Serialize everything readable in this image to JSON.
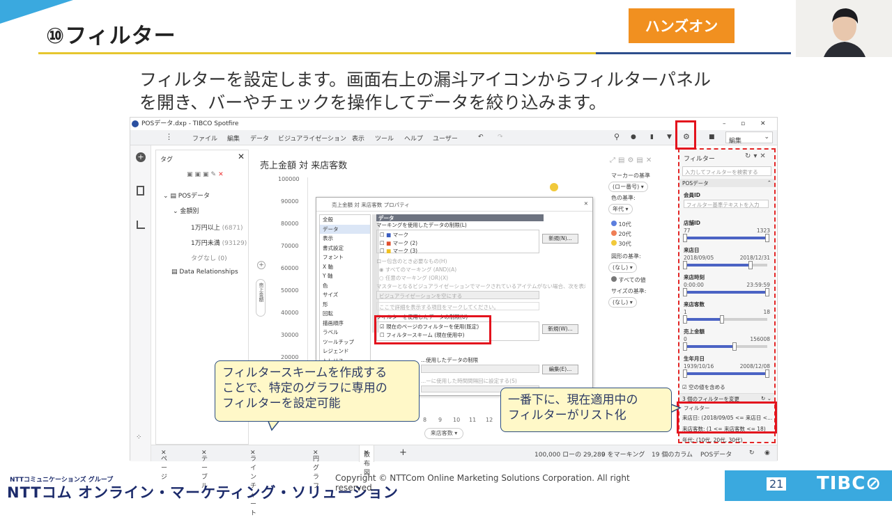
{
  "slide": {
    "title": "⑩フィルター",
    "badge": "ハンズオン",
    "description_line1": "フィルターを設定します。画面右上の漏斗アイコンからフィルターパネル",
    "description_line2": "を開き、バーやチェックを操作してデータを絞り込みます。"
  },
  "app": {
    "window_title": "POSデータ.dxp - TIBCO Spotfire",
    "menu": [
      "ファイル",
      "編集",
      "データ",
      "ビジュアライゼーション",
      "表示",
      "ツール",
      "ヘルプ",
      "ユーザー"
    ],
    "edit_mode": "編集",
    "tag_panel": {
      "title": "タグ",
      "items": [
        "POSデータ",
        "金額別",
        "1万円以上",
        "(6871)",
        "1万円未満",
        "(93129)",
        "タグなし (0)",
        "Data Relationships"
      ]
    },
    "chart": {
      "title": "売上金額 対 来店客数",
      "y_ticks": [
        "100000",
        "90000",
        "80000",
        "70000",
        "60000",
        "50000",
        "40000",
        "30000",
        "20000"
      ],
      "x_ticks": [
        "8",
        "9",
        "10",
        "11",
        "12"
      ],
      "x_axis": "来店客数",
      "y_axis": "売上金額"
    },
    "legend": {
      "marker_label": "マーカーの基準",
      "marker_value": "(ロー番号)",
      "color_label": "色の基準:",
      "color_value": "年代",
      "items": [
        {
          "label": "10代",
          "color": "#5b7ede"
        },
        {
          "label": "20代",
          "color": "#ef7e56"
        },
        {
          "label": "30代",
          "color": "#f1c93a"
        }
      ],
      "shape_label": "図形の基準:",
      "shape_value": "(なし)",
      "shape_item": "すべての値",
      "size_label": "サイズの基準:",
      "size_value": "(なし)"
    },
    "filter_panel": {
      "title": "フィルター",
      "search_placeholder": "入力してフィルターを検索する",
      "group": "POSデータ",
      "fields": [
        {
          "name": "会員ID",
          "type": "text",
          "placeholder": "フィルター基準テキストを入力"
        },
        {
          "name": "店舗ID",
          "type": "range",
          "min": "77",
          "max": "1323",
          "lo": 0.0,
          "hi": 1.0
        },
        {
          "name": "来店日",
          "type": "range",
          "min": "2018/09/05",
          "max": "2018/12/31",
          "lo": 0.0,
          "hi": 0.8
        },
        {
          "name": "来店時刻",
          "type": "range",
          "min": "0:00:00",
          "max": "23:59:59",
          "lo": 0.0,
          "hi": 1.0
        },
        {
          "name": "来店客数",
          "type": "range",
          "min": "1",
          "max": "18",
          "lo": 0.0,
          "hi": 0.45
        },
        {
          "name": "売上金額",
          "type": "range",
          "min": "0",
          "max": "156008",
          "lo": 0.0,
          "hi": 0.6
        },
        {
          "name": "生年月日",
          "type": "range",
          "min": "1939/10/16",
          "max": "2008/12/08",
          "lo": 0.0,
          "hi": 1.0
        }
      ],
      "empty_values": "空の値を含める",
      "change_count": "3 個のフィルターを変更",
      "applied_header": "フィルター",
      "applied": [
        "来店日: (2018/09/05 <= 来店日 <...",
        "来店客数: (1 <= 来店客数 <= 18)",
        "年代: (10代, 20代, 30代)"
      ]
    },
    "dialog": {
      "title": "売上金額 対 来店客数 プロパティ",
      "nav": [
        "全般",
        "データ",
        "表示",
        "書式設定",
        "フォント",
        "X 軸",
        "Y 軸",
        "色",
        "サイズ",
        "形",
        "回転",
        "描画順序",
        "ラベル",
        "ツールチップ",
        "レジェンド",
        "トレリス"
      ],
      "section": "データ",
      "marking_label": "マーキングを使用したデータの制限(L)",
      "markings": [
        "マーク",
        "マーク (2)",
        "マーク (3)"
      ],
      "new_button": "新規(N)...",
      "optional": "ロー包含のとき必要なもの(H)",
      "opt1": "すべてのマーキング (AND)(A)",
      "opt2": "任意のマーキング (OR)(X)",
      "master_text": "マスターとなるビジュアライゼーションでマークされているアイテムがない場合、次を表示(I)",
      "empty_viz": "ビジュアライゼーションを空にする",
      "hint": "ここで詳細を表示する項目をマークしてください。",
      "filter_label": "フィルターを使用したデータの制限(U)",
      "filter_opt1": "現在のページのフィルターを使用(既定)",
      "filter_opt2": "フィルタースキーム (現在使用中)",
      "new_button2": "新規(W)...",
      "limit_label": "...使用したデータの制限",
      "edit_button": "編集(E)...",
      "hidden_text": "...ーに使用した時間間隔回に設定する(S)"
    },
    "tabs": [
      "ページ",
      "テーブル",
      "ラインチャート",
      "円グラフ",
      "散布図"
    ],
    "status": [
      "100,000 ローの 29,289",
      "0 をマーキング",
      "19 個のカラム",
      "POSデータ"
    ]
  },
  "callouts": {
    "left": [
      "フィルタースキームを作成する",
      "ことで、特定のグラフに専用の",
      "フィルターを設定可能"
    ],
    "right": [
      "一番下に、現在適用中の",
      "フィルターがリスト化"
    ]
  },
  "footer": {
    "company_small": "NTTコミュニケーションズ グループ",
    "company": "NTTコム オンライン・マーケティング・ソリューション",
    "copyright": "Copyright © NTTCom Online Marketing Solutions Corporation. All right reserved.",
    "page": "21",
    "brand": "TIBC⊘"
  }
}
